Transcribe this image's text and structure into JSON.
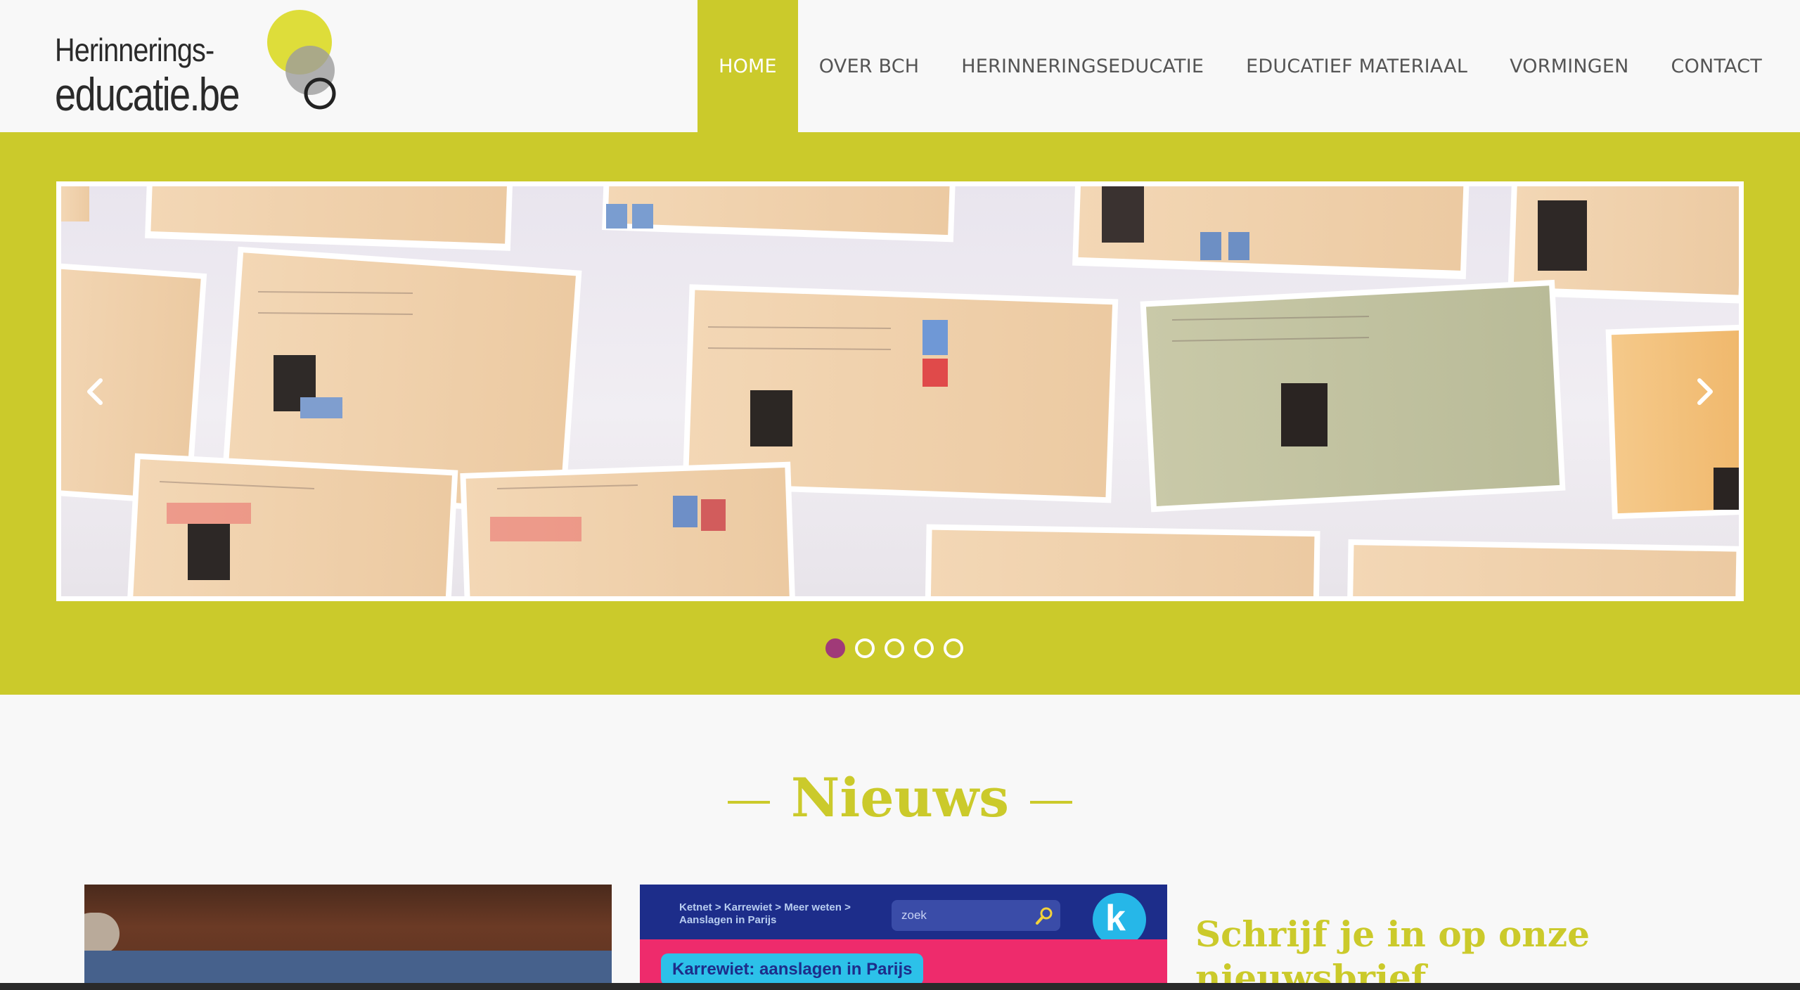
{
  "logo": {
    "line1": "Herinnerings-",
    "line2": "educatie.be"
  },
  "nav": {
    "items": [
      {
        "label": "HOME",
        "active": true
      },
      {
        "label": "OVER BCH"
      },
      {
        "label": "HERINNERINGSEDUCATIE"
      },
      {
        "label": "EDUCATIEF MATERIAAL"
      },
      {
        "label": "VORMINGEN"
      },
      {
        "label": "CONTACT"
      }
    ]
  },
  "slider": {
    "image_alt": "Identiteitskaarten aan de muur",
    "slide_count": 5,
    "active_index": 0
  },
  "news": {
    "title": "Nieuws",
    "card2": {
      "breadcrumb_line1": "Ketnet > Karrewiet > Meer weten >",
      "breadcrumb_line2": "Aanslagen in Parijs",
      "search_placeholder": "zoek",
      "headline": "Karrewiet: aanslagen in Parijs",
      "badge": "k"
    }
  },
  "newsletter": {
    "title_line1": "Schrijf je in op onze",
    "title_line2": "nieuwsbrief"
  },
  "colors": {
    "accent": "#cbca2b",
    "active_dot": "#a03a78",
    "background": "#f8f8f8"
  }
}
